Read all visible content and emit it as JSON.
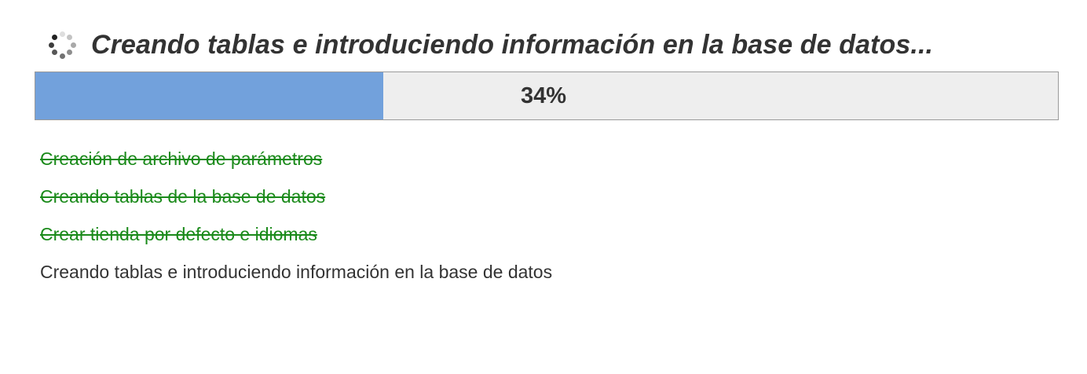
{
  "header": {
    "title": "Creando tablas e introduciendo información en la base de datos...",
    "icon": "loading-spinner-icon"
  },
  "progress": {
    "percent": 34,
    "label": "34%",
    "fill_color": "#72a1dc",
    "track_color": "#eeeeee"
  },
  "steps": [
    {
      "label": "Creación de archivo de parámetros",
      "status": "done"
    },
    {
      "label": "Creando tablas de la base de datos",
      "status": "done"
    },
    {
      "label": "Crear tienda por defecto e idiomas",
      "status": "done"
    },
    {
      "label": "Creando tablas e introduciendo información en la base de datos",
      "status": "current"
    }
  ],
  "colors": {
    "done": "#1a8a1a",
    "text": "#333333"
  }
}
